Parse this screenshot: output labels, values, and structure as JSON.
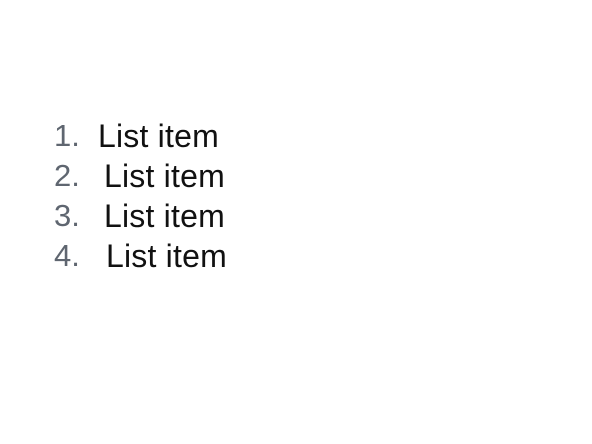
{
  "list": {
    "items": [
      {
        "number": "1.",
        "label": "List item"
      },
      {
        "number": "2.",
        "label": "List item"
      },
      {
        "number": "3.",
        "label": "List item"
      },
      {
        "number": "4.",
        "label": "List item"
      }
    ]
  },
  "colors": {
    "background": "#ffffff",
    "number": "#5f6670",
    "text": "#111111"
  }
}
